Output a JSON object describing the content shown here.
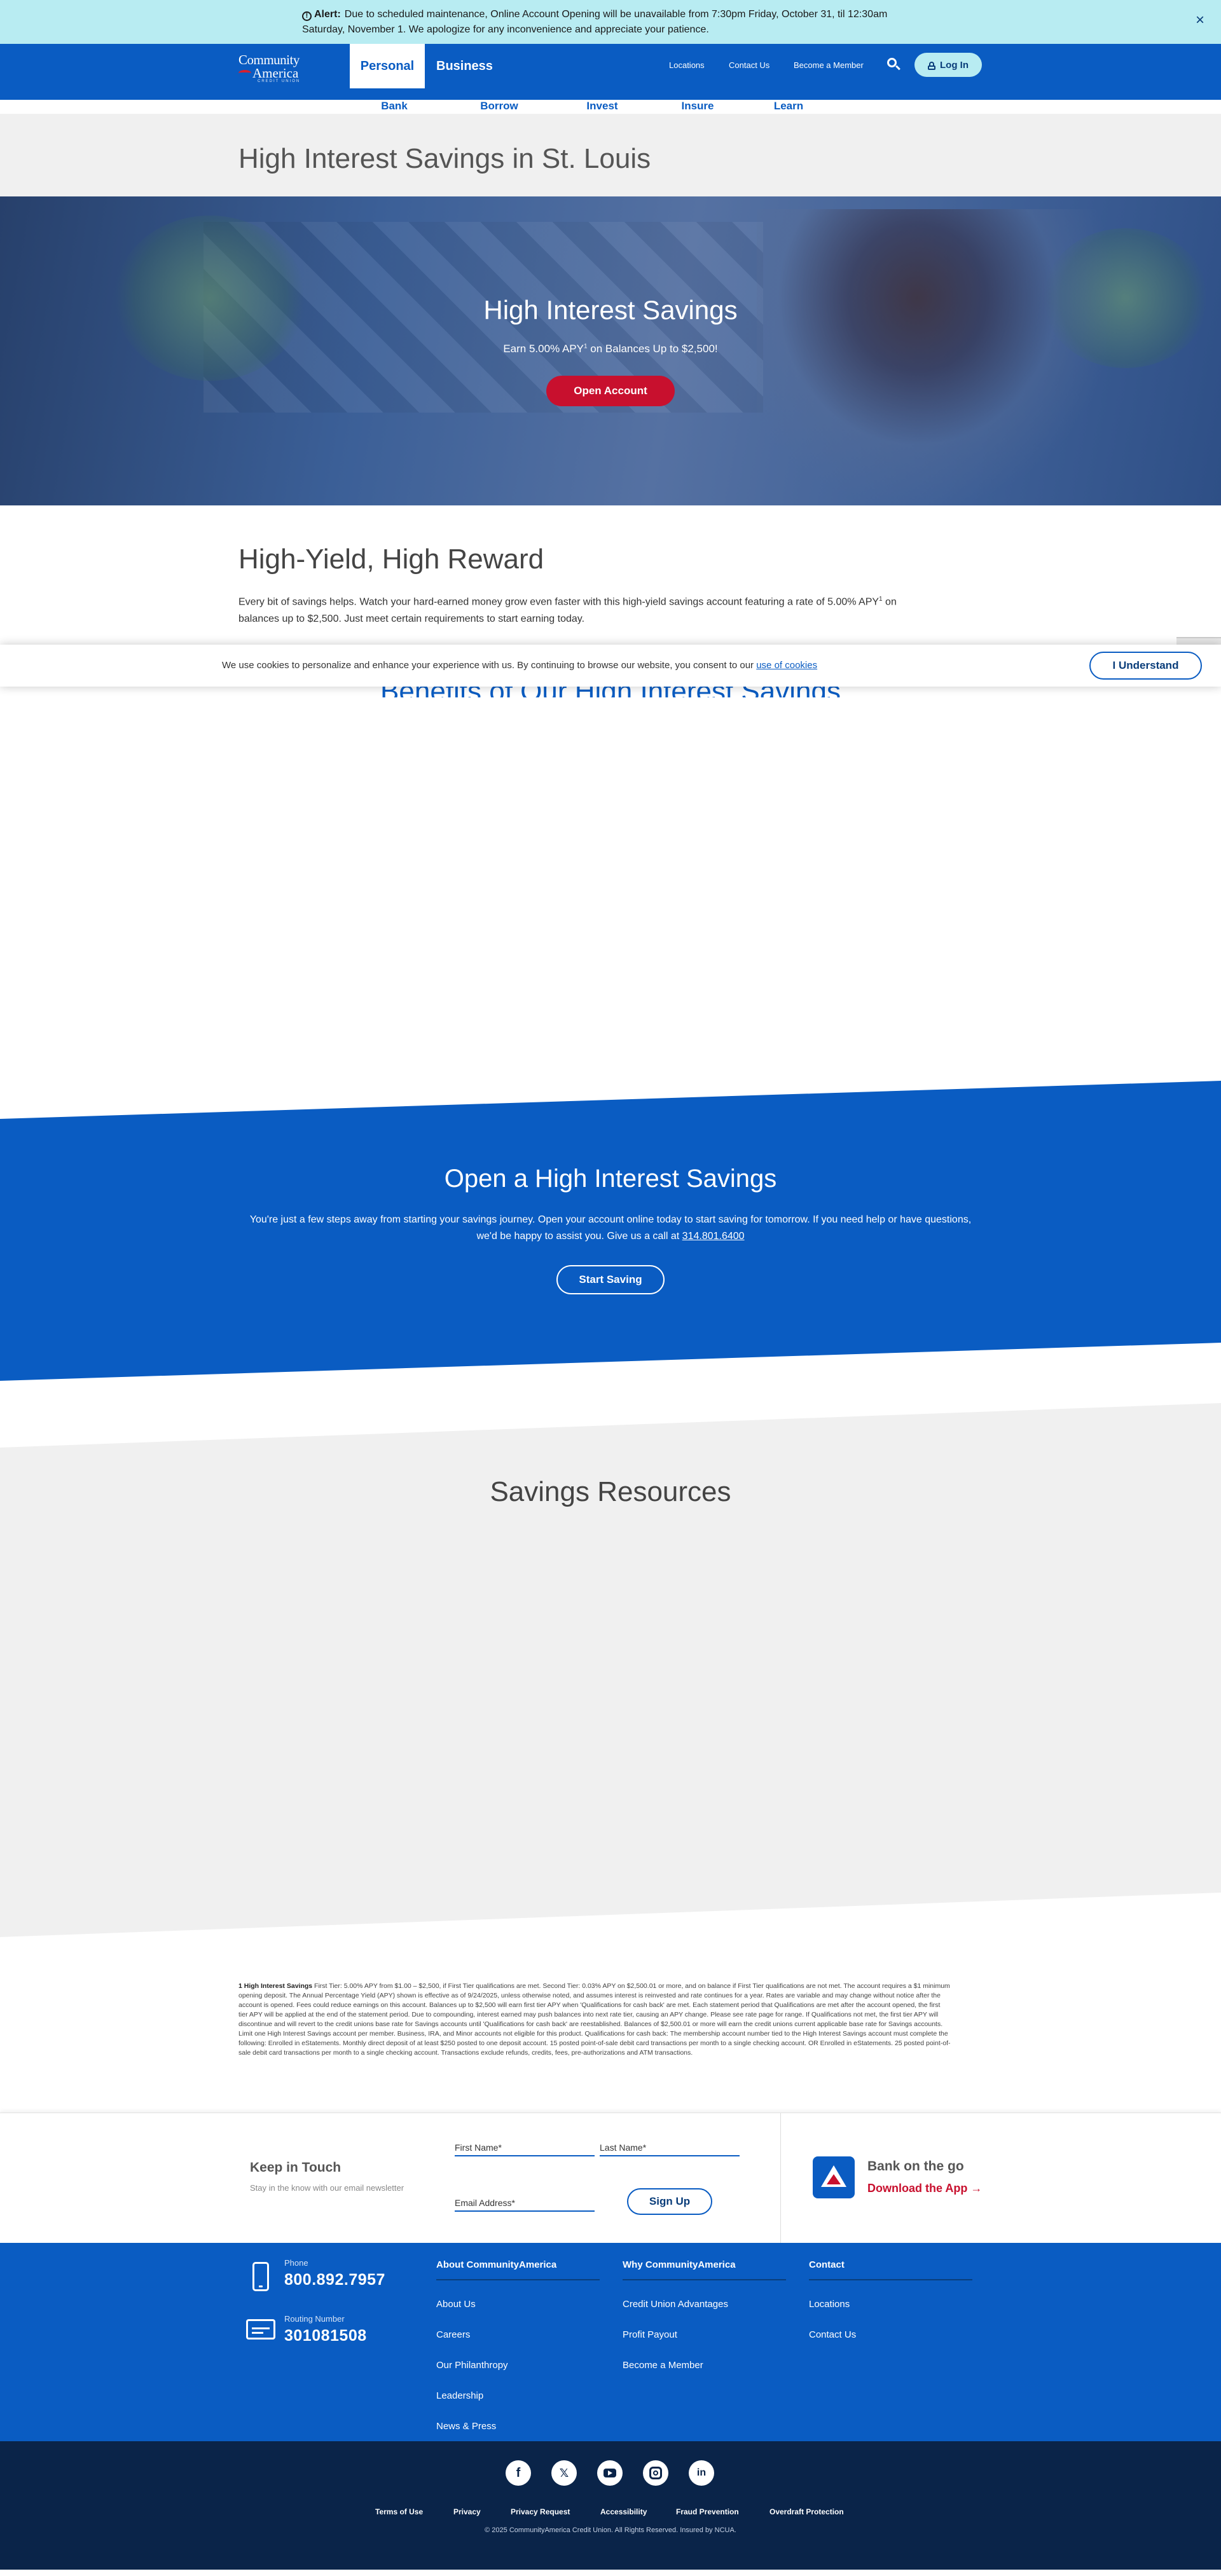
{
  "alert": {
    "label": "Alert:",
    "line1": "Due to scheduled maintenance, Online Account Opening will be unavailable from 7:30pm Friday, October 31, til 12:30am",
    "line2": "Saturday, November 1. We apologize for any inconvenience and appreciate your patience.",
    "icon": "alert-circle-icon",
    "close": "×",
    "background": "#b8ecf2"
  },
  "header": {
    "logo_line1": "Community",
    "logo_line2": "America",
    "logo_tag": "CREDIT UNION",
    "tabs": [
      "Personal",
      "Business"
    ],
    "util_links": [
      "Locations",
      "Contact Us",
      "Become a Member"
    ],
    "login_label": "Log In",
    "search_icon": "search-icon",
    "brand_color": "#0a5cc2"
  },
  "subnav": [
    "Bank",
    "Borrow",
    "Invest",
    "Insure",
    "Learn"
  ],
  "page_title": "High Interest Savings in St. Louis",
  "hero": {
    "title": "High Interest Savings",
    "sub_before": "Earn 5.00% APY",
    "sub_sup": "1",
    "sub_after": " on Balances Up to $2,500!",
    "cta": "Open Account",
    "cta_color": "#c8102e"
  },
  "high_yield": {
    "heading": "High-Yield, High Reward",
    "body_before": "Every bit of savings helps. Watch your hard-earned money grow even faster with this high-yield savings account featuring a rate of 5.00% APY",
    "body_sup": "1",
    "body_after": " on balances up to $2,500. Just meet certain requirements to start earning today."
  },
  "cookie": {
    "text": "We use cookies to personalize and enhance your experience with us. By continuing to browse our website, you consent to our",
    "link": "use of cookies",
    "button": "I Understand"
  },
  "benefits_heading": "Benefits of Our High Interest Savings",
  "open_savings": {
    "heading": "Open a High Interest Savings",
    "body": "You're just a few steps away from starting your savings journey. Open your account online today to start saving for tomorrow. If you need help or have questions, we'd be happy to assist you. Give us a call at",
    "phone": "314.801.6400",
    "cta": "Start Saving"
  },
  "resources_heading": "Savings Resources",
  "disclosure": {
    "label": "1 High Interest Savings",
    "text": "First Tier: 5.00% APY from $1.00 – $2,500, if First Tier qualifications are met. Second Tier: 0.03% APY on $2,500.01 or more, and on balance if First Tier qualifications are not met. The account requires a $1 minimum opening deposit. The Annual Percentage Yield (APY) shown is effective as of 9/24/2025, unless otherwise noted, and assumes interest is reinvested and rate continues for a year. Rates are variable and may change without notice after the account is opened. Fees could reduce earnings on this account. Balances up to $2,500 will earn first tier APY when 'Qualifications for cash back' are met. Each statement period that Qualifications are met after the account opened, the first tier APY will be applied at the end of the statement period. Due to compounding, interest earned may push balances into next rate tier, causing an APY change. Please see rate page for range. If Qualifications not met, the first tier APY will discontinue and will revert to the credit unions base rate for Savings accounts until 'Qualifications for cash back' are reestablished. Balances of $2,500.01 or more will earn the credit unions current applicable base rate for Savings accounts. Limit one High Interest Savings account per member. Business, IRA, and Minor accounts not eligible for this product. Qualifications for cash back: The membership account number tied to the High Interest Savings account must complete the following: Enrolled in eStatements. Monthly direct deposit of at least $250 posted to one deposit account. 15 posted point-of-sale debit card transactions per month to a single checking account. OR Enrolled in eStatements. 25 posted point-of-sale debit card transactions per month to a single checking account. Transactions exclude refunds, credits, fees, pre-authorizations and ATM transactions."
  },
  "newsletter": {
    "title": "Keep in Touch",
    "subtitle": "Stay in the know with our email newsletter",
    "first_name": "First Name*",
    "last_name": "Last Name*",
    "email": "Email Address*",
    "signup": "Sign Up",
    "app_title": "Bank on the go",
    "app_link": "Download the App →"
  },
  "footer": {
    "phone_label": "Phone",
    "phone_value": "800.892.7957",
    "routing_label": "Routing Number",
    "routing_value": "301081508",
    "columns": [
      {
        "heading": "About CommunityAmerica",
        "links": [
          "About Us",
          "Careers",
          "Our Philanthropy",
          "Leadership",
          "News & Press"
        ]
      },
      {
        "heading": "Why CommunityAmerica",
        "links": [
          "Credit Union Advantages",
          "Profit Payout",
          "Become a Member"
        ]
      },
      {
        "heading": "Contact",
        "links": [
          "Locations",
          "Contact Us"
        ]
      }
    ],
    "social": [
      "facebook-icon",
      "x-icon",
      "youtube-icon",
      "instagram-icon",
      "linkedin-icon"
    ],
    "legal": [
      "Terms of Use",
      "Privacy",
      "Privacy Request",
      "Accessibility",
      "Fraud Prevention",
      "Overdraft Protection"
    ],
    "copyright": "© 2025 CommunityAmerica Credit Union. All Rights Reserved. Insured by NCUA."
  }
}
